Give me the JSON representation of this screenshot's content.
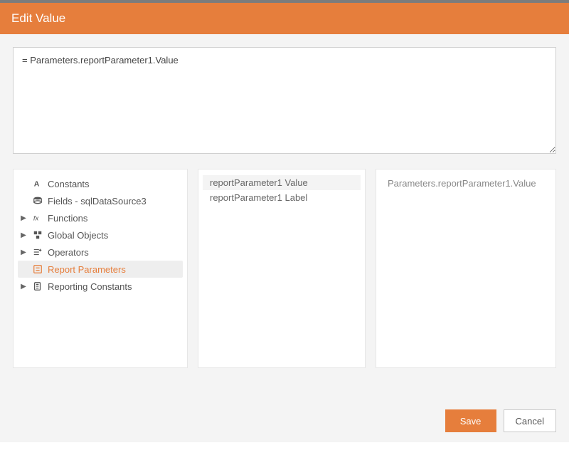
{
  "header": {
    "title": "Edit Value"
  },
  "expression": {
    "value": "= Parameters.reportParameter1.Value"
  },
  "tree": {
    "items": [
      {
        "label": "Constants",
        "icon": "constants-icon",
        "expandable": false
      },
      {
        "label": "Fields - sqlDataSource3",
        "icon": "fields-icon",
        "expandable": false
      },
      {
        "label": "Functions",
        "icon": "functions-icon",
        "expandable": true
      },
      {
        "label": "Global Objects",
        "icon": "globals-icon",
        "expandable": true
      },
      {
        "label": "Operators",
        "icon": "operators-icon",
        "expandable": true
      },
      {
        "label": "Report Parameters",
        "icon": "params-icon",
        "expandable": false,
        "selected": true
      },
      {
        "label": "Reporting Constants",
        "icon": "repconst-icon",
        "expandable": true
      }
    ]
  },
  "list": {
    "items": [
      {
        "label": "reportParameter1 Value",
        "hl": true
      },
      {
        "label": "reportParameter1 Label",
        "hl": false
      }
    ]
  },
  "detail": {
    "text": "Parameters.reportParameter1.Value"
  },
  "buttons": {
    "save": "Save",
    "cancel": "Cancel"
  }
}
